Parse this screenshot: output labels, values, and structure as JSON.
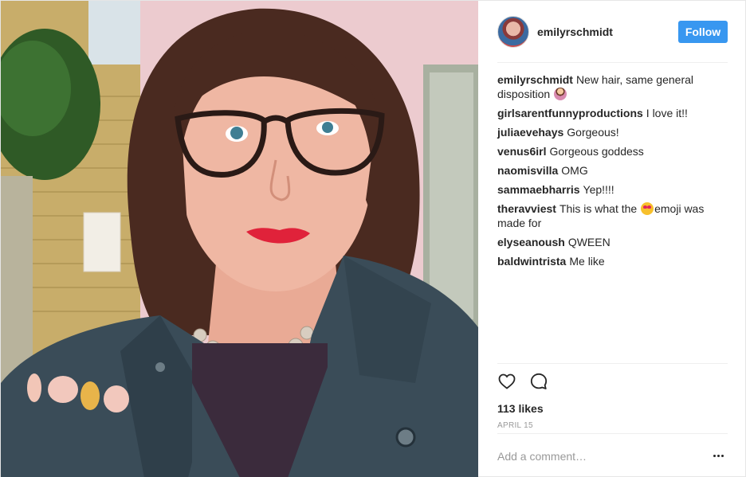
{
  "post": {
    "username": "emilyrschmidt",
    "follow_label": "Follow",
    "caption": {
      "author": "emilyrschmidt",
      "text": "New hair, same general disposition",
      "emoji": "person-tipping-hand-emoji"
    },
    "comments": [
      {
        "author": "girlsarentfunnyproductions",
        "text": "I love it!!"
      },
      {
        "author": "juliaevehays",
        "text": "Gorgeous!"
      },
      {
        "author": "venus6irl",
        "text": "Gorgeous goddess"
      },
      {
        "author": "naomisvilla",
        "text": "OMG"
      },
      {
        "author": "sammaebharris",
        "text": "Yep!!!!"
      },
      {
        "author": "theravviest",
        "text_before": "This is what the",
        "emoji": "heart-eyes-emoji",
        "text_after": "emoji was made for"
      },
      {
        "author": "elyseanoush",
        "text": "QWEEN"
      },
      {
        "author": "baldwintrista",
        "text": "Me like"
      }
    ],
    "likes": "113 likes",
    "date": "APRIL 15",
    "add_comment_placeholder": "Add a comment…",
    "icons": {
      "like": "heart-icon",
      "comment": "comment-bubble-icon",
      "more": "more-options-icon"
    },
    "colors": {
      "follow_bg": "#3897f0",
      "lips": "#e0223a"
    }
  }
}
